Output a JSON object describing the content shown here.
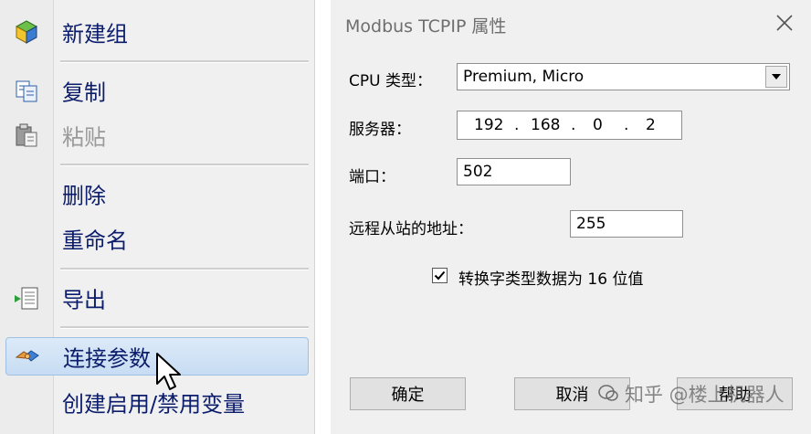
{
  "context_menu": {
    "items": [
      {
        "label": "新建组",
        "icon": "new-group-icon",
        "enabled": true
      },
      {
        "label": "复制",
        "icon": "copy-icon",
        "enabled": true
      },
      {
        "label": "粘贴",
        "icon": "paste-icon",
        "enabled": false
      },
      {
        "label": "删除",
        "enabled": true
      },
      {
        "label": "重命名",
        "enabled": true
      },
      {
        "label": "导出",
        "icon": "export-icon",
        "enabled": true
      },
      {
        "label": "连接参数",
        "icon": "connection-params-icon",
        "enabled": true,
        "highlighted": true
      },
      {
        "label": "创建启用/禁用变量",
        "enabled": true
      }
    ]
  },
  "dialog": {
    "title": "Modbus TCPIP 属性",
    "cpu_type": {
      "label": "CPU 类型：",
      "value": "Premium, Micro"
    },
    "server": {
      "label": "服务器：",
      "octets": [
        "192",
        "168",
        "0",
        "2"
      ]
    },
    "port": {
      "label": "端口：",
      "value": "502"
    },
    "remote_slave": {
      "label": "远程从站的地址：",
      "value": "255"
    },
    "checkbox": {
      "label": "转换字类型数据为 16 位值",
      "checked": true
    },
    "buttons": {
      "ok": "确定",
      "cancel": "取消",
      "help": "帮助"
    }
  },
  "watermark": "知乎 @楼上机器人",
  "colors": {
    "menu_text": "#0b1d6b",
    "disabled_text": "#9a9a9a",
    "highlight": "#c7dcf3"
  }
}
